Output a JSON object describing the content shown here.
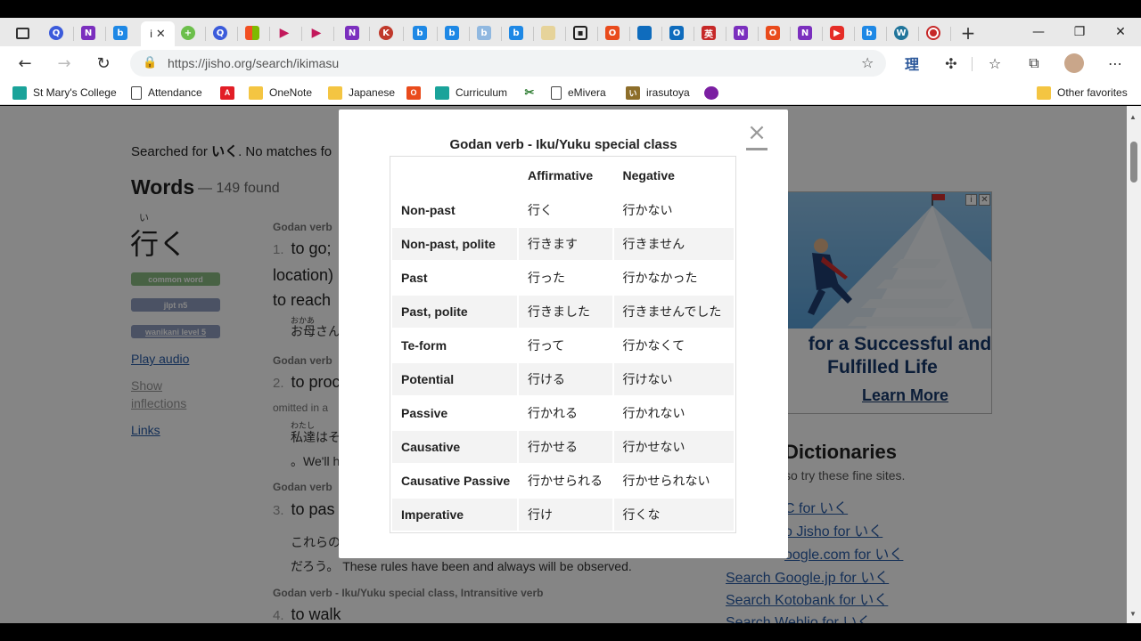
{
  "browser": {
    "active_tab_label": "i",
    "url": "https://jisho.org/search/ikimasu",
    "favorites": [
      {
        "label": "St Mary's College"
      },
      {
        "label": "Attendance"
      },
      {
        "label": ""
      },
      {
        "label": "OneNote"
      },
      {
        "label": "Japanese"
      },
      {
        "label": ""
      },
      {
        "label": "Curriculum"
      },
      {
        "label": ""
      },
      {
        "label": "eMivera"
      },
      {
        "label": "irasutoya"
      },
      {
        "label": ""
      }
    ],
    "other_favorites": "Other favorites",
    "reader_glyph": "理",
    "accent_color": "#2a5da8"
  },
  "page": {
    "searched_prefix": "Searched for",
    "searched_term": "いく",
    "searched_suffix": ". No matches fo",
    "words_heading": "Words",
    "words_count": "— 149 found",
    "entry_furigana": "い",
    "entry_word": "行く",
    "tags": [
      "common word",
      "jlpt n5",
      "wanikani level 5"
    ],
    "links": {
      "play_audio": "Play audio",
      "show": "Show",
      "inflections": "inflections",
      "links": "Links"
    },
    "meanings": [
      {
        "head": "Godan verb",
        "num": "1.",
        "text": "to go;"
      },
      {
        "extra1": "location)",
        "extra2": "to reach"
      },
      {
        "furigana": "おかあ",
        "sentence": "お母さん"
      },
      {
        "head": "Godan verb",
        "num": "2.",
        "text": "to proc"
      },
      {
        "note": "omitted in a",
        "furigana": "わたし",
        "sentence": "私達はそ",
        "english": "。We'll h"
      },
      {
        "head": "Godan verb",
        "num": "3.",
        "text": "to pas"
      },
      {
        "sentence1": "これらの",
        "sentence2": "だろう。",
        "english2": "These rules have been and always will be observed."
      },
      {
        "head": "Godan verb - Iku/Yuku special class, Intransitive verb",
        "num": "4.",
        "text": "to walk"
      }
    ],
    "ad": {
      "headline_1": "for a Successful and",
      "headline_2": "Fulfilled Life",
      "cta": "Learn More"
    },
    "dictionaries": {
      "title": "Dictionaries",
      "subtitle": "so try these fine sites.",
      "items": [
        "C for いく",
        "o Jisho for いく",
        "oogle.com for いく",
        "Search Google.jp for いく",
        "Search Kotobank for いく",
        "Search Weblio for いく"
      ]
    }
  },
  "modal": {
    "title": "Godan verb - Iku/Yuku special class",
    "close_glyph": "×",
    "columns": [
      "",
      "Affirmative",
      "Negative"
    ],
    "rows": [
      {
        "form": "Non-past",
        "affirmative": "行く",
        "negative": "行かない"
      },
      {
        "form": "Non-past, polite",
        "affirmative": "行きます",
        "negative": "行きません"
      },
      {
        "form": "Past",
        "affirmative": "行った",
        "negative": "行かなかった"
      },
      {
        "form": "Past, polite",
        "affirmative": "行きました",
        "negative": "行きませんでした"
      },
      {
        "form": "Te-form",
        "affirmative": "行って",
        "negative": "行かなくて"
      },
      {
        "form": "Potential",
        "affirmative": "行ける",
        "negative": "行けない"
      },
      {
        "form": "Passive",
        "affirmative": "行かれる",
        "negative": "行かれない"
      },
      {
        "form": "Causative",
        "affirmative": "行かせる",
        "negative": "行かせない"
      },
      {
        "form": "Causative Passive",
        "affirmative": "行かせられる",
        "negative": "行かせられない"
      },
      {
        "form": "Imperative",
        "affirmative": "行け",
        "negative": "行くな"
      }
    ]
  }
}
